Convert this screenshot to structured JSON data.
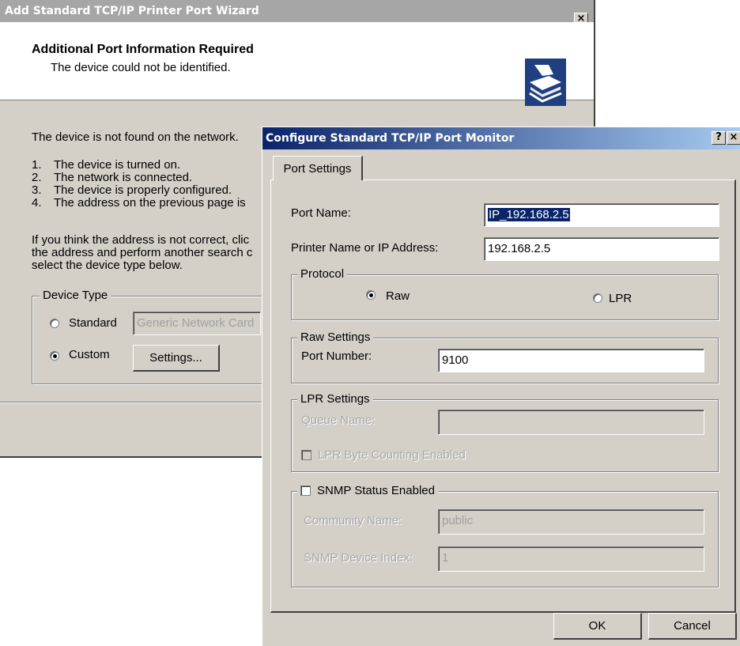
{
  "wizard": {
    "title": "Add Standard TCP/IP Printer Port Wizard",
    "close_label": "×",
    "header_title": "Additional Port Information Required",
    "header_subtitle": "The device could not be identified.",
    "intro": "The device is not found on the network.",
    "checklist": [
      {
        "num": "1.",
        "text": "The device is turned on."
      },
      {
        "num": "2.",
        "text": "The network is connected."
      },
      {
        "num": "3.",
        "text": "The device is properly configured."
      },
      {
        "num": "4.",
        "text": "The address on the previous page is"
      }
    ],
    "hint_lines": [
      "If you think the address is not correct, clic",
      "the address and perform another search c",
      "select the device type below."
    ],
    "device_type": {
      "label": "Device Type",
      "standard_label": "Standard",
      "standard_value": "Generic Network Card",
      "custom_label": "Custom",
      "settings_button": "Settings..."
    }
  },
  "dialog": {
    "title": "Configure Standard TCP/IP Port Monitor",
    "help_label": "?",
    "close_label": "×",
    "tab_label": "Port Settings",
    "port_name_label": "Port Name:",
    "port_name_value": "IP_192.168.2.5",
    "printer_address_label": "Printer Name or IP Address:",
    "printer_address_value": "192.168.2.5",
    "protocol": {
      "label": "Protocol",
      "raw_label": "Raw",
      "lpr_label": "LPR",
      "selected": "Raw"
    },
    "raw_settings": {
      "label": "Raw Settings",
      "port_number_label": "Port Number:",
      "port_number_value": "9100"
    },
    "lpr_settings": {
      "label": "LPR Settings",
      "queue_name_label": "Queue Name:",
      "queue_name_value": "",
      "byte_counting_label": "LPR Byte Counting Enabled"
    },
    "snmp": {
      "label": "SNMP Status Enabled",
      "community_name_label": "Community Name:",
      "community_name_value": "public",
      "device_index_label": "SNMP Device Index:",
      "device_index_value": "1"
    },
    "ok_button": "OK",
    "cancel_button": "Cancel"
  }
}
